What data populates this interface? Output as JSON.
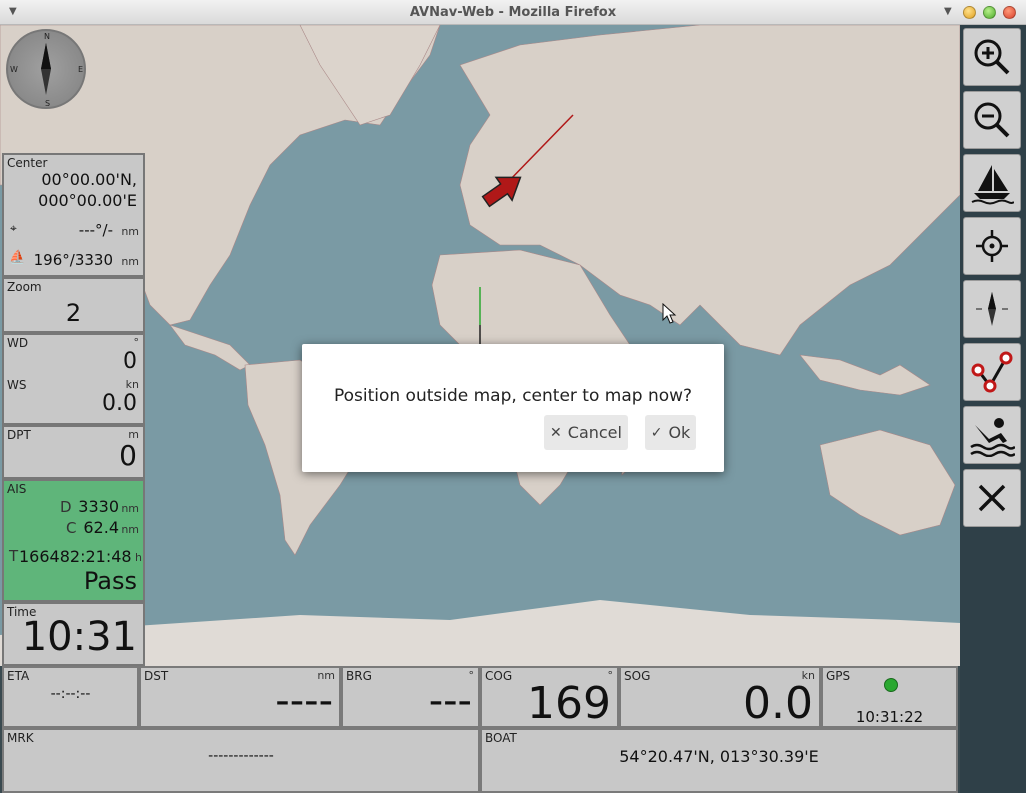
{
  "window": {
    "title": "AVNav-Web - Mozilla Firefox"
  },
  "compass": {
    "n": "N",
    "s": "S",
    "e": "E",
    "w": "W"
  },
  "center": {
    "label": "Center",
    "lat": "00°00.00'N,",
    "lon": "000°00.00'E",
    "dist_value": "---°/-",
    "dist_unit": "nm",
    "boat_value": "196°/3330",
    "boat_unit": "nm"
  },
  "zoom": {
    "label": "Zoom",
    "value": "2"
  },
  "wind": {
    "wd_label": "WD",
    "wd_unit": "°",
    "wd_value": "0",
    "ws_label": "WS",
    "ws_unit": "kn",
    "ws_value": "0.0"
  },
  "depth": {
    "label": "DPT",
    "unit": "m",
    "value": "0"
  },
  "ais": {
    "label": "AIS",
    "d_label": "D",
    "d_value": "3330",
    "d_unit": "nm",
    "c_label": "C",
    "c_value": "62.4",
    "c_unit": "nm",
    "t_label": "T",
    "t_value": "166482:21:48",
    "t_unit": "h",
    "status": "Pass",
    "color": "#5fb57a"
  },
  "time": {
    "label": "Time",
    "value": "10:31"
  },
  "bottom": {
    "eta": {
      "label": "ETA",
      "value": "--:--:--"
    },
    "dst": {
      "label": "DST",
      "unit": "nm",
      "value": "----"
    },
    "brg": {
      "label": "BRG",
      "unit": "°",
      "value": "---"
    },
    "cog": {
      "label": "COG",
      "unit": "°",
      "value": "169"
    },
    "sog": {
      "label": "SOG",
      "unit": "kn",
      "value": "0.0"
    },
    "gps": {
      "label": "GPS",
      "time": "10:31:22",
      "status_color": "#2aa830"
    },
    "mrk": {
      "label": "MRK",
      "value": "-------------"
    },
    "boat": {
      "label": "BOAT",
      "value": "54°20.47'N, 013°30.39'E"
    }
  },
  "dialog": {
    "message": "Position outside map, center to map now?",
    "cancel_label": "Cancel",
    "ok_label": "Ok"
  },
  "toolbar": {
    "icons": [
      "zoom-in-icon",
      "zoom-out-icon",
      "boat-icon",
      "crosshair-icon",
      "compass-icon",
      "route-icon",
      "mob-icon",
      "close-icon"
    ]
  }
}
